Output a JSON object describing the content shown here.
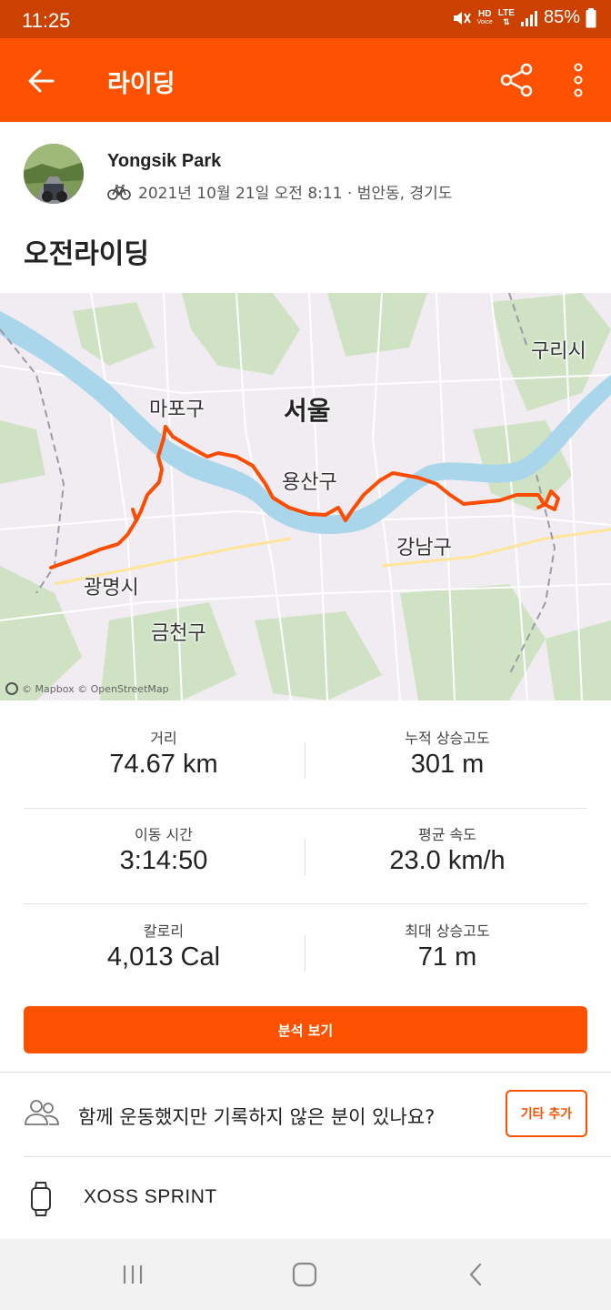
{
  "status_bar": {
    "time": "11:25",
    "hd_top": "HD",
    "hd_bottom": "Voice",
    "network": "LTE",
    "battery": "85%"
  },
  "app_bar": {
    "title": "라이딩",
    "back_icon": "back-arrow-icon",
    "share_icon": "share-icon",
    "more_icon": "more-vertical-icon"
  },
  "activity": {
    "athlete_name": "Yongsik Park",
    "sport_icon": "bike-icon",
    "date_location": "2021년 10월 21일 오전 8:11 · 범안동, 경기도",
    "title": "오전라이딩"
  },
  "map": {
    "labels": {
      "seoul": "서울",
      "mapo": "마포구",
      "yongsan": "용산구",
      "gangnam": "강남구",
      "gwangmyeong": "광명시",
      "geumcheon": "금천구",
      "guri": "구리시"
    },
    "attribution": "© Mapbox © OpenStreetMap",
    "route_color": "#fc4c02"
  },
  "stats": [
    {
      "label": "거리",
      "value": "74.67 km"
    },
    {
      "label": "누적 상승고도",
      "value": "301 m"
    },
    {
      "label": "이동 시간",
      "value": "3:14:50"
    },
    {
      "label": "평균 속도",
      "value": "23.0 km/h"
    },
    {
      "label": "칼로리",
      "value": "4,013 Cal"
    },
    {
      "label": "최대 상승고도",
      "value": "71 m"
    }
  ],
  "analysis_button": "분석 보기",
  "group_prompt": {
    "text": "함께 운동했지만 기록하지 않은 분이 있나요?",
    "button": "기타 추가",
    "icon": "people-icon"
  },
  "device": {
    "name": "XOSS SPRINT",
    "icon": "watch-icon"
  },
  "colors": {
    "brand": "#fc5200",
    "status_bar": "#cc4100"
  }
}
